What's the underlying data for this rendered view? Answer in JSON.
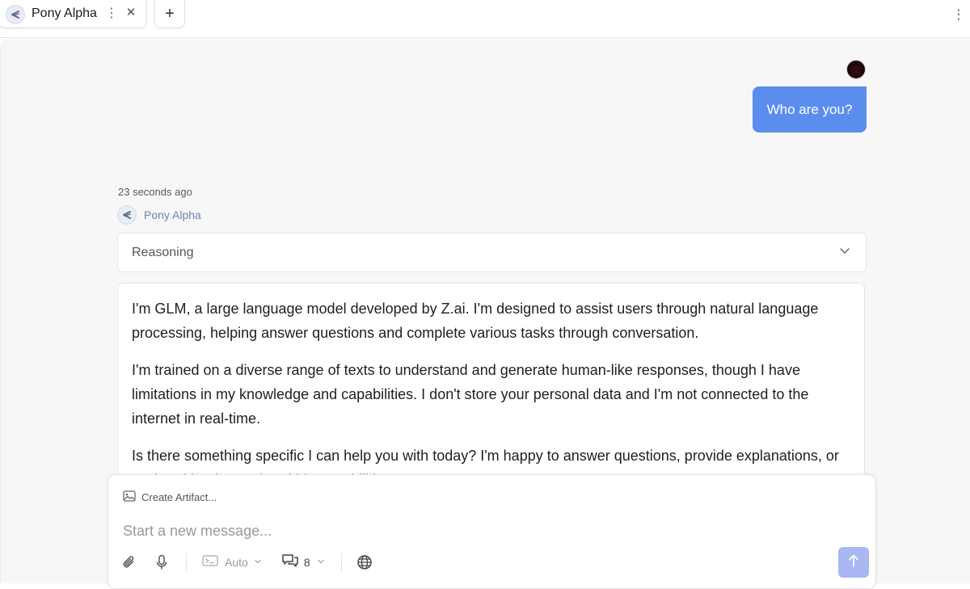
{
  "tab": {
    "title": "Pony Alpha",
    "menu_icon": "vertical-dots-icon",
    "close_icon": "close-icon",
    "new_tab_icon": "plus-icon"
  },
  "window": {
    "menu_icon": "vertical-dots-icon"
  },
  "conversation": {
    "user_message": "Who are you?",
    "timestamp": "23 seconds ago",
    "assistant_name": "Pony Alpha",
    "reasoning_label": "Reasoning",
    "response_paragraphs": [
      "I'm GLM, a large language model developed by Z.ai. I'm designed to assist users through natural language processing, helping answer questions and complete various tasks through conversation.",
      "I'm trained on a diverse range of texts to understand and generate human-like responses, though I have limitations in my knowledge and capabilities. I don't store your personal data and I'm not connected to the internet in real-time.",
      "Is there something specific I can help you with today? I'm happy to answer questions, provide explanations, or assist with other tasks within my abilities."
    ]
  },
  "composer": {
    "create_artifact_label": "Create Artifact...",
    "placeholder": "Start a new message...",
    "mode_label": "Auto",
    "context_count": "8",
    "icons": [
      "paperclip-icon",
      "microphone-icon",
      "mode-icon",
      "chat-bubbles-icon",
      "globe-icon",
      "send-arrow-icon"
    ]
  },
  "colors": {
    "user_bubble": "#5b8def",
    "send_button": "#a9b8f2",
    "assistant_name": "#6b84b8"
  }
}
